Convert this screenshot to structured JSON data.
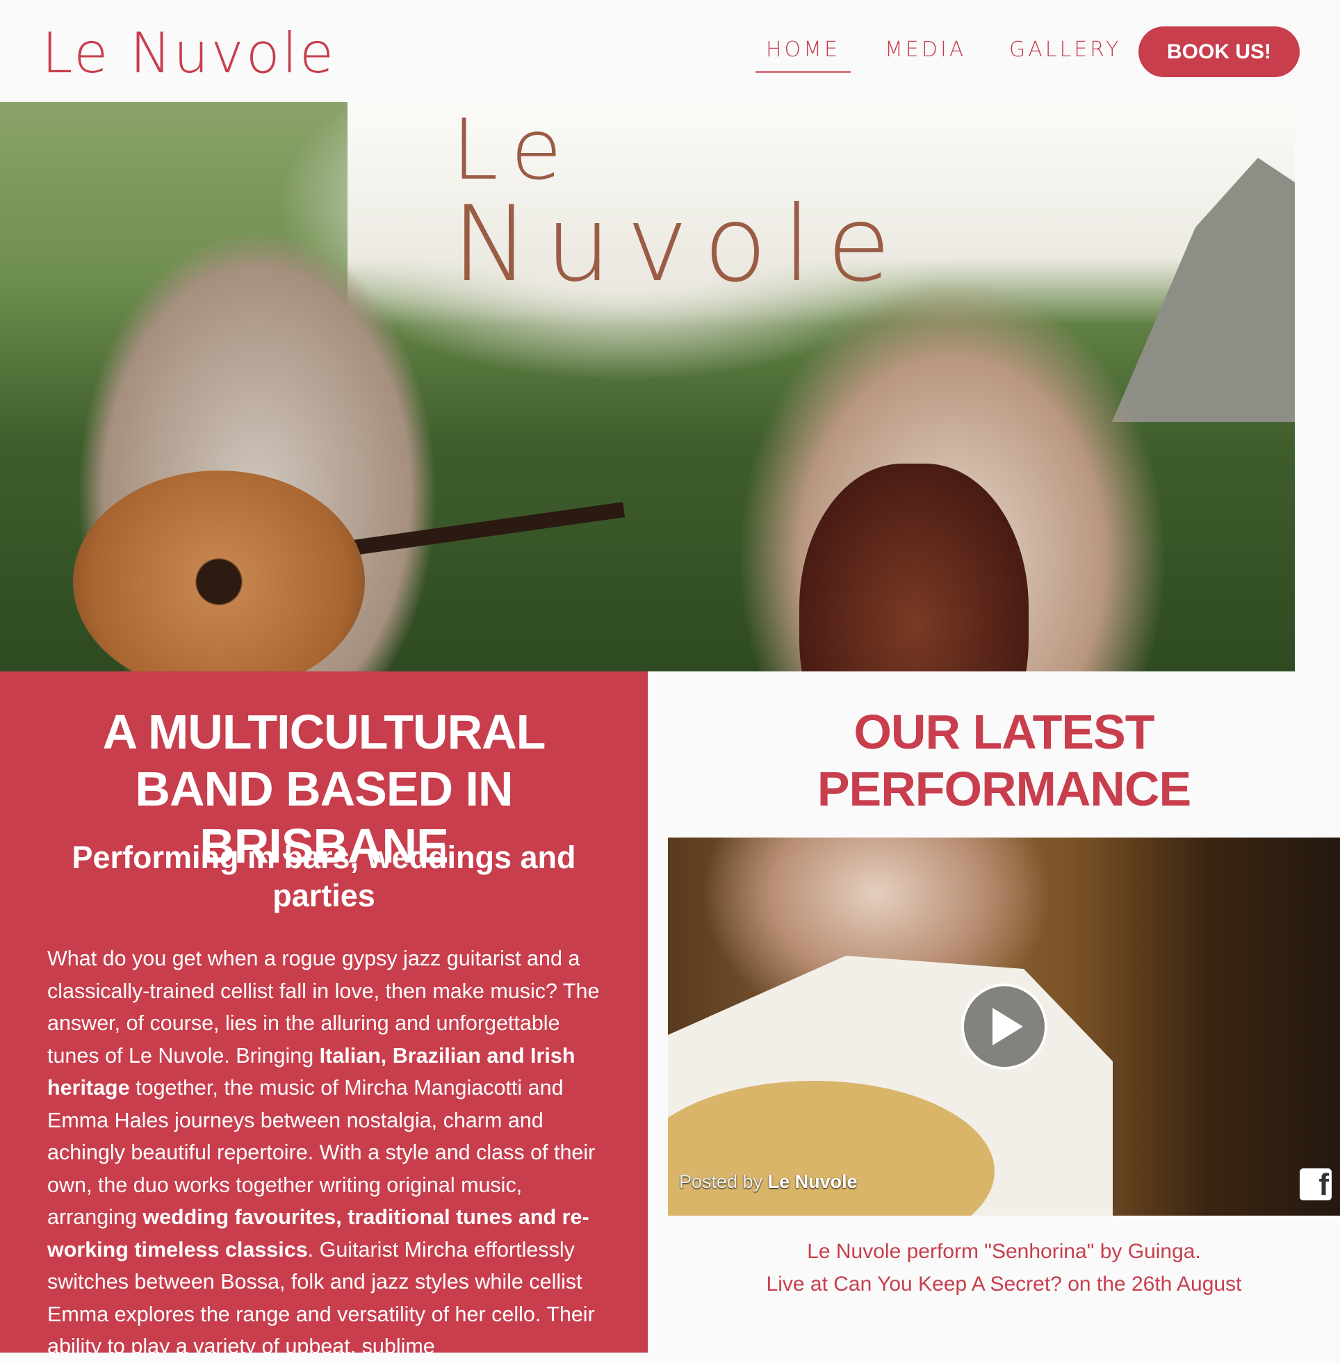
{
  "header": {
    "logo": "Le Nuvole",
    "nav": [
      "HOME",
      "MEDIA",
      "GALLERY"
    ],
    "book_label": "BOOK US!"
  },
  "hero": {
    "logo_line1": "Le",
    "logo_line2": "Nuvole"
  },
  "intro": {
    "title": "A MULTICULTURAL BAND BASED IN BRISBANE",
    "subtitle": "Performing in bars, weddings and parties",
    "p1": "What do you get when a rogue gypsy jazz guitarist and a classically-trained cellist fall in love, then make music? The answer, of course, lies in the alluring and unforgettable tunes of Le Nuvole. Bringing ",
    "b1": "Italian, Brazilian and Irish heritage",
    "p2": " together, the music of Mircha Mangiacotti and Emma Hales journeys between nostalgia, charm and achingly beautiful repertoire. With a style and class of their own, the duo works together writing original music, arranging ",
    "b2": "wedding favourites, traditional tunes and re-working timeless classics",
    "p3": ". Guitarist Mircha effortlessly switches between Bossa, folk and jazz styles while cellist Emma explores the range and versatility of her cello. Their ability to play a variety of upbeat, sublime"
  },
  "latest": {
    "title": "OUR LATEST PERFORMANCE",
    "posted_by": "Posted by",
    "posted_name": "Le Nuvole",
    "fb_glyph": "f",
    "caption_line1": "Le Nuvole perform \"Senhorina\" by Guinga.",
    "caption_line2": "Live at Can You Keep A Secret? on the 26th August"
  },
  "colors": {
    "accent": "#c83e4d",
    "background": "#fafafa"
  }
}
